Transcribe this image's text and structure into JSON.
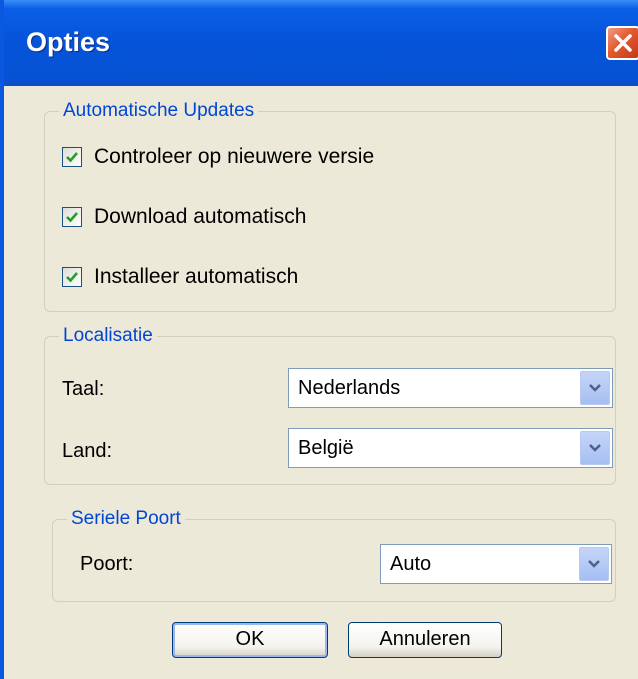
{
  "window": {
    "title": "Opties"
  },
  "updates": {
    "legend": "Automatische Updates",
    "options": [
      {
        "label": "Controleer op nieuwere versie",
        "checked": true
      },
      {
        "label": "Download automatisch",
        "checked": true
      },
      {
        "label": "Installeer automatisch",
        "checked": true
      }
    ]
  },
  "localisation": {
    "legend": "Localisatie",
    "language_label": "Taal:",
    "language_value": "Nederlands",
    "country_label": "Land:",
    "country_value": "België"
  },
  "serial": {
    "legend": "Seriele Poort",
    "port_label": "Poort:",
    "port_value": "Auto"
  },
  "buttons": {
    "ok": "OK",
    "cancel": "Annuleren"
  },
  "colors": {
    "titlebar": "#0553d8",
    "legend_text": "#0046d5",
    "checkmark": "#21a121",
    "dialog_bg": "#ece9d8"
  },
  "icons": {
    "close": "close-icon",
    "checkmark": "checkmark-icon",
    "dropdown": "chevron-down-icon"
  }
}
